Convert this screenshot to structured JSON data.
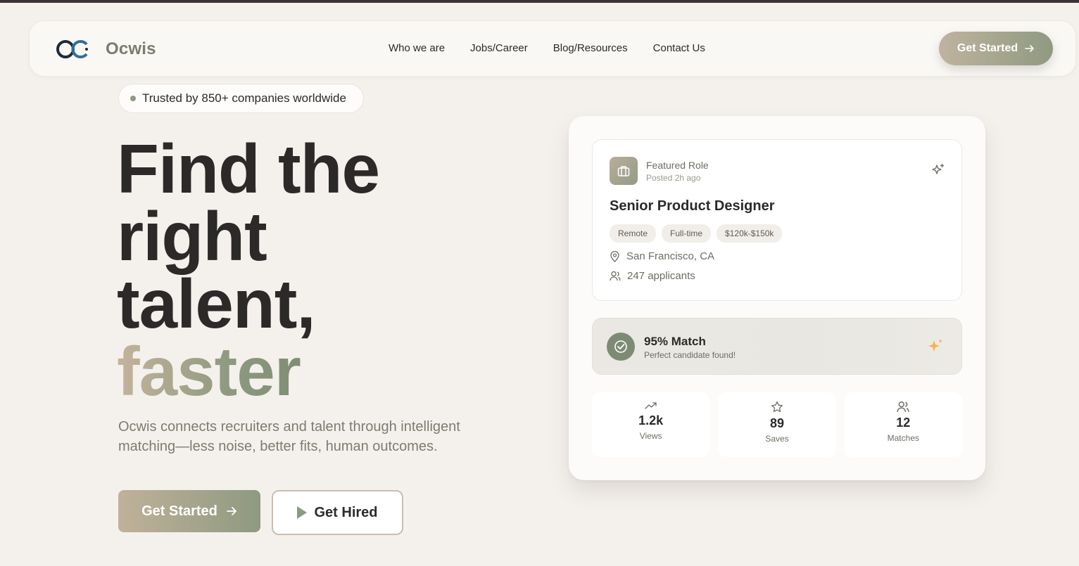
{
  "brand": {
    "name": "Ocwis"
  },
  "nav": {
    "links": [
      "Who we are",
      "Jobs/Career",
      "Blog/Resources",
      "Contact Us"
    ],
    "cta_label": "Get Started"
  },
  "hero": {
    "trust_badge": "Trusted by 850+ companies worldwide",
    "headline_line1": "Find the",
    "headline_line2": "right",
    "headline_line3": "talent,",
    "headline_accent": "faster",
    "subtitle": "Ocwis connects recruiters and talent through intelligent matching—less noise, better fits, human outcomes.",
    "primary_cta": "Get Started",
    "secondary_cta": "Get Hired"
  },
  "card": {
    "role_tag": "Featured Role",
    "posted": "Posted 2h ago",
    "role_title": "Senior Product Designer",
    "chips": [
      "Remote",
      "Full-time",
      "$120k-$150k"
    ],
    "location": "San Francisco, CA",
    "applicants": "247 applicants",
    "match_title": "95% Match",
    "match_sub": "Perfect candidate found!",
    "stats": [
      {
        "value": "1.2k",
        "label": "Views",
        "icon": "trending-up-icon"
      },
      {
        "value": "89",
        "label": "Saves",
        "icon": "star-icon"
      },
      {
        "value": "12",
        "label": "Matches",
        "icon": "users-icon"
      }
    ]
  },
  "colors": {
    "accent_start": "#c0b19a",
    "accent_end": "#8e9a80",
    "background": "#f4f1ed"
  }
}
